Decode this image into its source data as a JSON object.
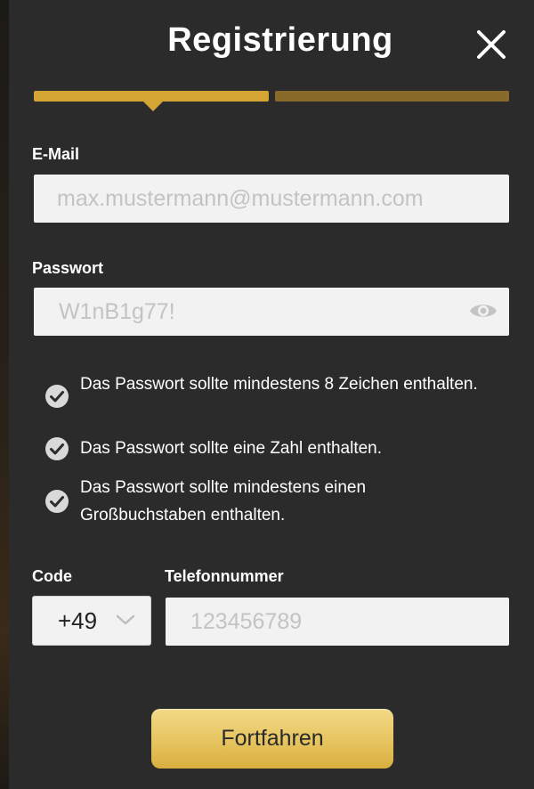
{
  "modal": {
    "title": "Registrierung",
    "close_icon": "close-icon"
  },
  "progress": {
    "current_step": 1,
    "total_steps": 2,
    "colors": {
      "active": "#d4a534",
      "inactive": "#8a6a2a"
    }
  },
  "email": {
    "label": "E-Mail",
    "value": "",
    "placeholder": "max.mustermann@mustermann.com"
  },
  "password": {
    "label": "Passwort",
    "value": "",
    "placeholder": "W1nB1g77!",
    "toggle_icon": "eye-icon"
  },
  "password_rules": [
    {
      "text": "Das Passwort sollte mindestens 8 Zeichen enthalten.",
      "satisfied": true,
      "icon": "check-circle-icon"
    },
    {
      "text": "Das Passwort sollte eine Zahl enthalten.",
      "satisfied": true,
      "icon": "check-circle-icon"
    },
    {
      "text": "Das Passwort sollte mindestens einen Großbuchstaben enthalten.",
      "satisfied": true,
      "icon": "check-circle-icon"
    }
  ],
  "phone": {
    "code_label": "Code",
    "code_value": "+49",
    "code_icon": "chevron-down-icon",
    "number_label": "Telefonnummer",
    "number_value": "",
    "number_placeholder": "123456789"
  },
  "continue_button": {
    "label": "Fortfahren",
    "color": "#e6c45f"
  }
}
